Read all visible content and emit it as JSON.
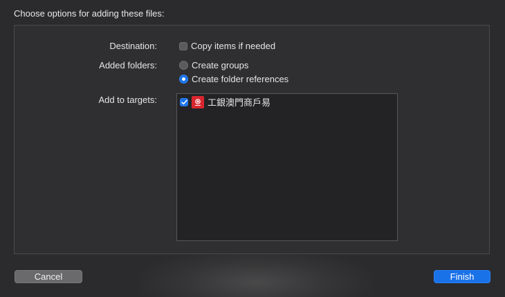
{
  "dialog": {
    "title": "Choose options for adding these files:"
  },
  "destination": {
    "label": "Destination:",
    "copy_items": {
      "label": "Copy items if needed",
      "checked": false
    }
  },
  "added_folders": {
    "label": "Added folders:",
    "options": [
      {
        "label": "Create groups",
        "selected": false
      },
      {
        "label": "Create folder references",
        "selected": true
      }
    ]
  },
  "targets": {
    "label": "Add to targets:",
    "items": [
      {
        "label": "工銀澳門商戶易",
        "checked": true,
        "icon": "icbc-app-icon",
        "icon_color": "#d8262f"
      }
    ]
  },
  "buttons": {
    "cancel": "Cancel",
    "finish": "Finish"
  },
  "colors": {
    "accent": "#1a72e8",
    "background": "#2b2b2d"
  }
}
